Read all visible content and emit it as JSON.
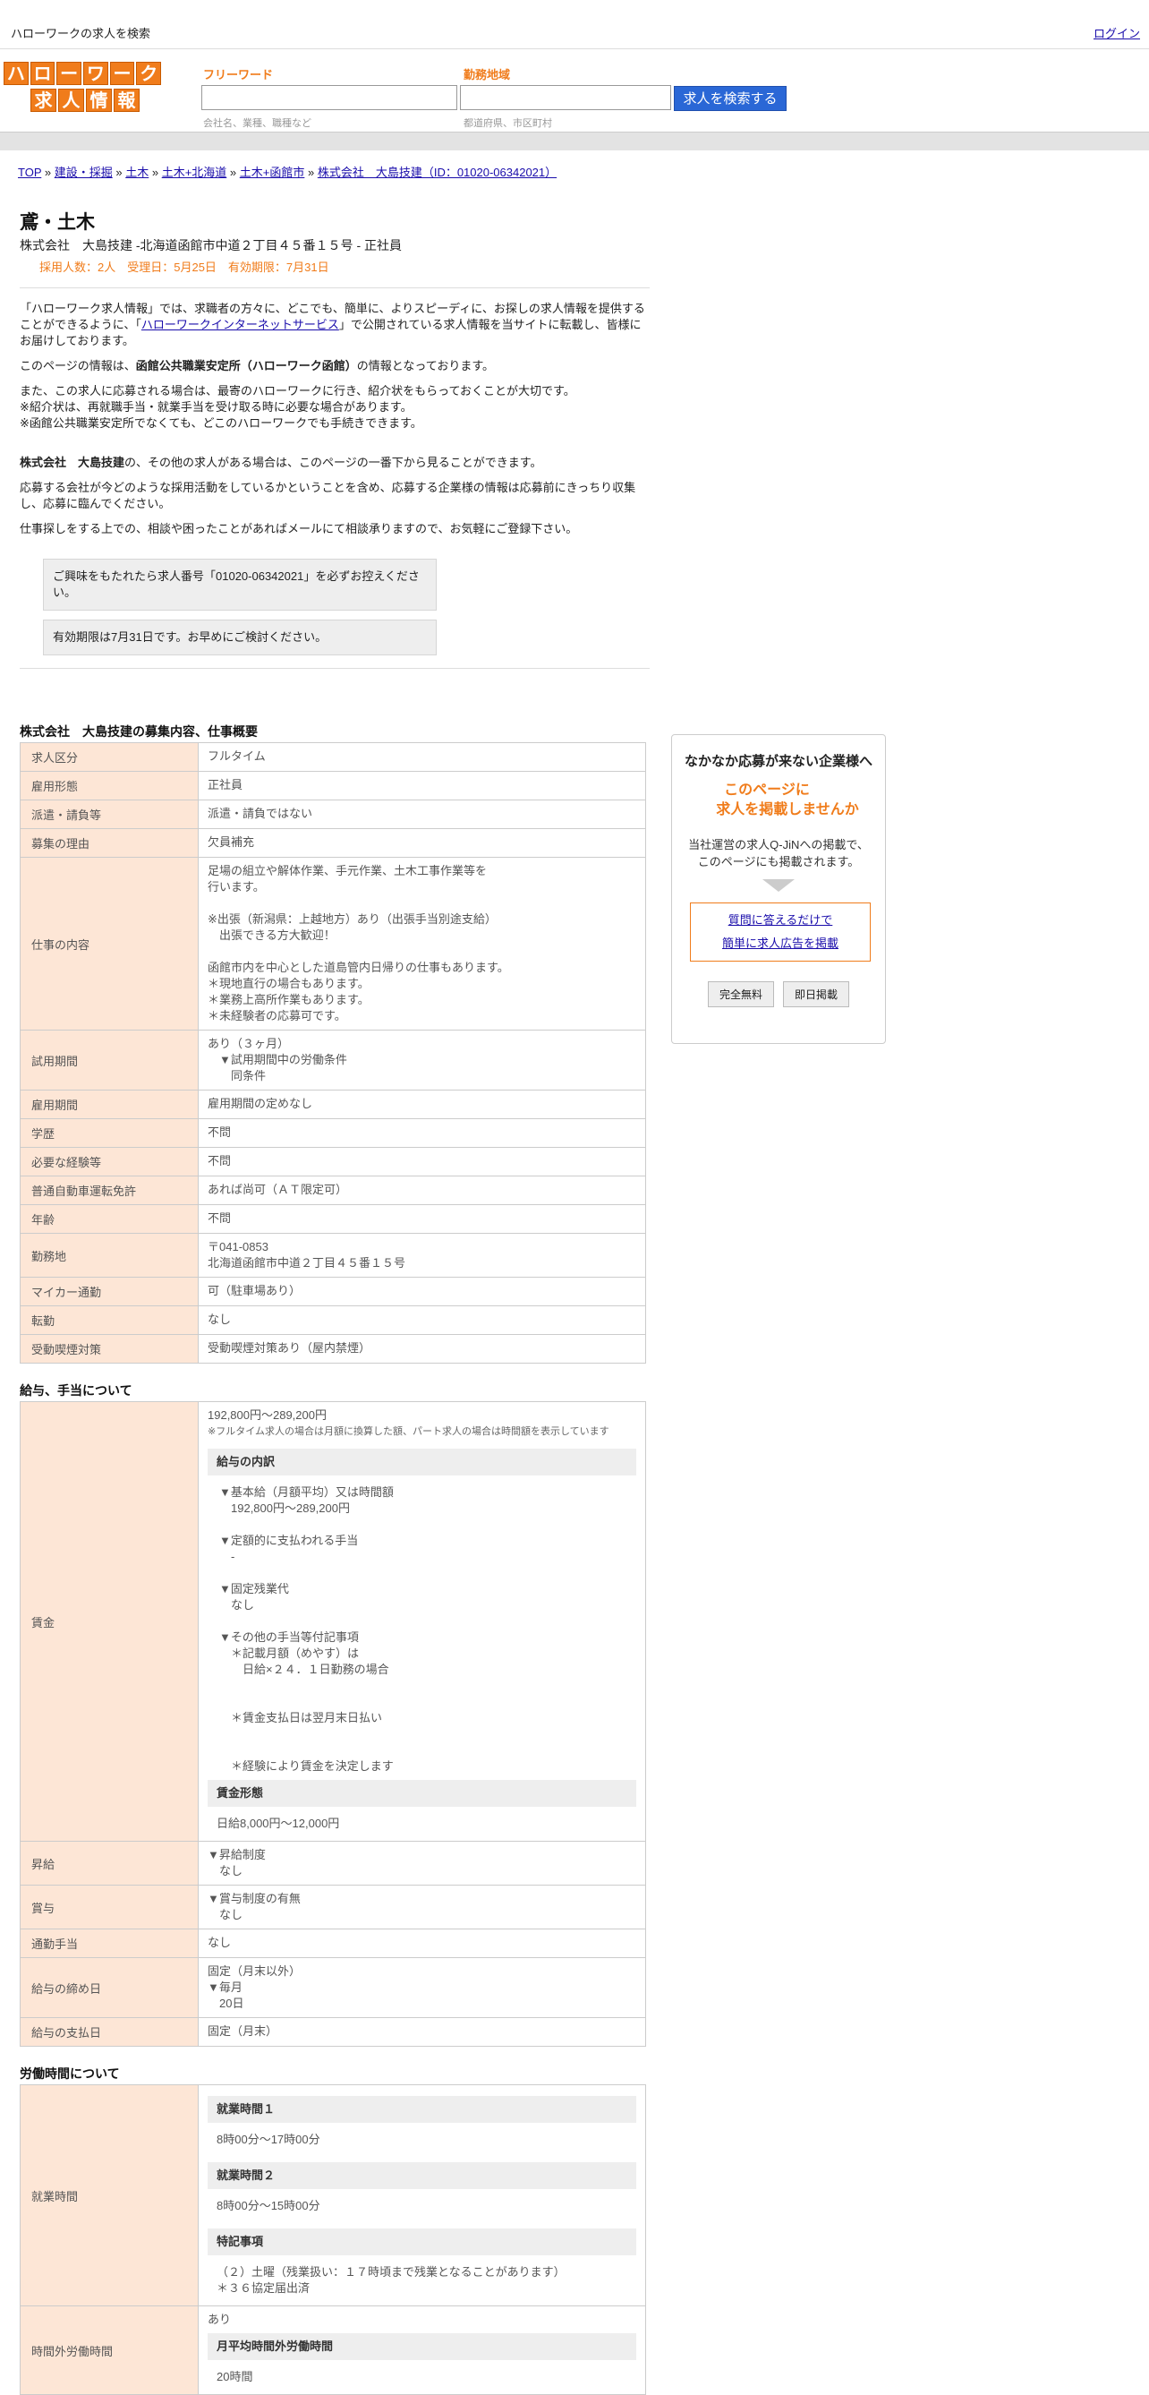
{
  "topbar": {
    "site_title": "ハローワークの求人を検索",
    "login": "ログイン"
  },
  "logo": {
    "row1": [
      "ハ",
      "ロ",
      "ー",
      "ワ",
      "ー",
      "ク"
    ],
    "row2": [
      "求",
      "人",
      "情",
      "報"
    ]
  },
  "search": {
    "freeword_label": "フリーワード",
    "freeword_placeholder": "会社名、業種、職種など",
    "area_label": "勤務地域",
    "area_placeholder": "都道府県、市区町村",
    "button": "求人を検索する"
  },
  "breadcrumb": {
    "items": [
      "TOP",
      "建設・採掘",
      "土木",
      "土木+北海道",
      "土木+函館市",
      "株式会社　大島技建（ID：01020-06342021）"
    ],
    "sep": " » "
  },
  "job": {
    "title": "鳶・土木",
    "company_line": "株式会社　大島技建 -北海道函館市中道２丁目４５番１５号 - 正社員",
    "meta": "採用人数：2人　受理日：5月25日　有効期限：7月31日"
  },
  "intro": {
    "p1a": "「ハローワーク求人情報」では、求職者の方々に、どこでも、簡単に、よりスピーディに、お探しの求人情報を提供することができるように、「",
    "p1_link": "ハローワークインターネットサービス",
    "p1b": "」で公開されている求人情報を当サイトに転載し、皆様にお届けしております。",
    "p2a": "このページの情報は、",
    "p2_bold": "函館公共職業安定所（ハローワーク函館）",
    "p2b": "の情報となっております。",
    "p3": "また、この求人に応募される場合は、最寄のハローワークに行き、紹介状をもらっておくことが大切です。\n※紹介状は、再就職手当・就業手当を受け取る時に必要な場合があります。\n※函館公共職業安定所でなくても、どこのハローワークでも手続きできます。",
    "p4_bold": "株式会社　大島技建",
    "p4b": "の、その他の求人がある場合は、このページの一番下から見ることができます。",
    "p5": "応募する会社が今どのような採用活動をしているかということを含め、応募する企業様の情報は応募前にきっちり収集し、応募に臨んでください。",
    "p6": "仕事探しをする上での、相談や困ったことがあればメールにて相談承りますので、お気軽にご登録下さい。",
    "notice1": "ご興味をもたれたら求人番号「01020-06342021」を必ずお控えください。",
    "notice2": "有効期限は7月31日です。お早めにご検討ください。"
  },
  "overview": {
    "title": "株式会社　大島技建の募集内容、仕事概要",
    "rows": [
      {
        "label": "求人区分",
        "value": "フルタイム"
      },
      {
        "label": "雇用形態",
        "value": "正社員"
      },
      {
        "label": "派遣・請負等",
        "value": "派遣・請負ではない"
      },
      {
        "label": "募集の理由",
        "value": "欠員補充"
      },
      {
        "label": "仕事の内容",
        "value": "足場の組立や解体作業、手元作業、土木工事作業等を\n行います。\n\n※出張（新潟県：上越地方）あり（出張手当別途支給）\n　出張できる方大歓迎！\n\n函館市内を中心とした道島管内日帰りの仕事もあります。\n＊現地直行の場合もあります。\n＊業務上高所作業もあります。\n＊未経験者の応募可です。"
      },
      {
        "label": "試用期間",
        "value": "あり（３ヶ月）\n　▼試用期間中の労働条件\n　　同条件"
      },
      {
        "label": "雇用期間",
        "value": "雇用期間の定めなし"
      },
      {
        "label": "学歴",
        "value": "不問"
      },
      {
        "label": "必要な経験等",
        "value": "不問"
      },
      {
        "label": "普通自動車運転免許",
        "value": "あれば尚可（ＡＴ限定可）"
      },
      {
        "label": "年齢",
        "value": "不問"
      },
      {
        "label": "勤務地",
        "value": "〒041-0853\n北海道函館市中道２丁目４５番１５号"
      },
      {
        "label": "マイカー通勤",
        "value": "可（駐車場あり）"
      },
      {
        "label": "転勤",
        "value": "なし"
      },
      {
        "label": "受動喫煙対策",
        "value": "受動喫煙対策あり（屋内禁煙）"
      }
    ]
  },
  "salary": {
    "title": "給与、手当について",
    "wage_label": "賃金",
    "wage_range": "192,800円〜289,200円",
    "wage_note": "※フルタイム求人の場合は月額に換算した額、パート求人の場合は時間額を表示しています",
    "breakdown_title": "給与の内訳",
    "breakdown": "　▼基本給（月額平均）又は時間額\n　　192,800円〜289,200円\n\n　▼定額的に支払われる手当\n　　-\n\n　▼固定残業代\n　　なし\n\n　▼その他の手当等付記事項\n　　＊記載月額（めやす）は\n　　　日給×２４．１日勤務の場合\n\n\n　　＊賃金支払日は翌月末日払い\n\n\n　　＊経験により賃金を決定します",
    "form_title": "賃金形態",
    "form_value": "日給8,000円〜12,000円",
    "rows": [
      {
        "label": "昇給",
        "value": "▼昇給制度\n　なし"
      },
      {
        "label": "賞与",
        "value": "▼賞与制度の有無\n　なし"
      },
      {
        "label": "通勤手当",
        "value": "なし"
      },
      {
        "label": "給与の締め日",
        "value": "固定（月末以外）\n▼毎月\n　20日"
      },
      {
        "label": "給与の支払日",
        "value": "固定（月末）"
      }
    ]
  },
  "hours": {
    "title": "労働時間について",
    "work_label": "就業時間",
    "shift1_title": "就業時間１",
    "shift1_value": "8時00分〜17時00分",
    "shift2_title": "就業時間２",
    "shift2_value": "8時00分〜15時00分",
    "notes_title": "特記事項",
    "notes_value": "（２）土曜（残業扱い：１７時頃まで残業となることがあります）\n＊３６協定届出済",
    "overtime_label": "時間外労働時間",
    "overtime_value": "あり",
    "overtime_sub_title": "月平均時間外労働時間",
    "overtime_sub_value": "20時間"
  },
  "sidebar": {
    "heading": "なかなか応募が来ない企業様へ",
    "orange_line1": "このページに",
    "orange_line2": "求人を掲載しませんか",
    "desc": "当社運営の求人Q-JiNへの掲載で、\nこのページにも掲載されます。",
    "link1": "質問に答えるだけで",
    "link2": "簡単に求人広告を掲載",
    "btn1": "完全無料",
    "btn2": "即日掲載"
  }
}
